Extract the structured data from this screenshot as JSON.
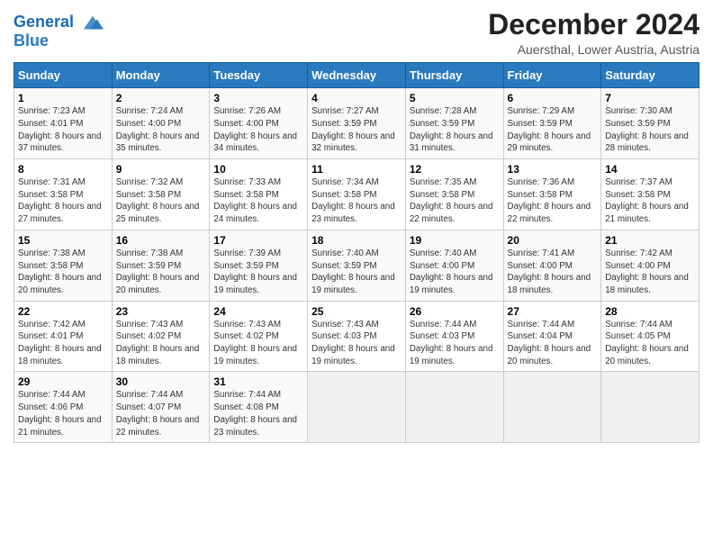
{
  "logo": {
    "line1": "General",
    "line2": "Blue"
  },
  "title": "December 2024",
  "subtitle": "Auersthal, Lower Austria, Austria",
  "header": {
    "days": [
      "Sunday",
      "Monday",
      "Tuesday",
      "Wednesday",
      "Thursday",
      "Friday",
      "Saturday"
    ]
  },
  "weeks": [
    [
      {
        "day": "1",
        "rise": "7:23 AM",
        "set": "4:01 PM",
        "daylight": "8 hours and 37 minutes."
      },
      {
        "day": "2",
        "rise": "7:24 AM",
        "set": "4:00 PM",
        "daylight": "8 hours and 35 minutes."
      },
      {
        "day": "3",
        "rise": "7:26 AM",
        "set": "4:00 PM",
        "daylight": "8 hours and 34 minutes."
      },
      {
        "day": "4",
        "rise": "7:27 AM",
        "set": "3:59 PM",
        "daylight": "8 hours and 32 minutes."
      },
      {
        "day": "5",
        "rise": "7:28 AM",
        "set": "3:59 PM",
        "daylight": "8 hours and 31 minutes."
      },
      {
        "day": "6",
        "rise": "7:29 AM",
        "set": "3:59 PM",
        "daylight": "8 hours and 29 minutes."
      },
      {
        "day": "7",
        "rise": "7:30 AM",
        "set": "3:59 PM",
        "daylight": "8 hours and 28 minutes."
      }
    ],
    [
      {
        "day": "8",
        "rise": "7:31 AM",
        "set": "3:58 PM",
        "daylight": "8 hours and 27 minutes."
      },
      {
        "day": "9",
        "rise": "7:32 AM",
        "set": "3:58 PM",
        "daylight": "8 hours and 25 minutes."
      },
      {
        "day": "10",
        "rise": "7:33 AM",
        "set": "3:58 PM",
        "daylight": "8 hours and 24 minutes."
      },
      {
        "day": "11",
        "rise": "7:34 AM",
        "set": "3:58 PM",
        "daylight": "8 hours and 23 minutes."
      },
      {
        "day": "12",
        "rise": "7:35 AM",
        "set": "3:58 PM",
        "daylight": "8 hours and 22 minutes."
      },
      {
        "day": "13",
        "rise": "7:36 AM",
        "set": "3:58 PM",
        "daylight": "8 hours and 22 minutes."
      },
      {
        "day": "14",
        "rise": "7:37 AM",
        "set": "3:58 PM",
        "daylight": "8 hours and 21 minutes."
      }
    ],
    [
      {
        "day": "15",
        "rise": "7:38 AM",
        "set": "3:58 PM",
        "daylight": "8 hours and 20 minutes."
      },
      {
        "day": "16",
        "rise": "7:38 AM",
        "set": "3:59 PM",
        "daylight": "8 hours and 20 minutes."
      },
      {
        "day": "17",
        "rise": "7:39 AM",
        "set": "3:59 PM",
        "daylight": "8 hours and 19 minutes."
      },
      {
        "day": "18",
        "rise": "7:40 AM",
        "set": "3:59 PM",
        "daylight": "8 hours and 19 minutes."
      },
      {
        "day": "19",
        "rise": "7:40 AM",
        "set": "4:00 PM",
        "daylight": "8 hours and 19 minutes."
      },
      {
        "day": "20",
        "rise": "7:41 AM",
        "set": "4:00 PM",
        "daylight": "8 hours and 18 minutes."
      },
      {
        "day": "21",
        "rise": "7:42 AM",
        "set": "4:00 PM",
        "daylight": "8 hours and 18 minutes."
      }
    ],
    [
      {
        "day": "22",
        "rise": "7:42 AM",
        "set": "4:01 PM",
        "daylight": "8 hours and 18 minutes."
      },
      {
        "day": "23",
        "rise": "7:43 AM",
        "set": "4:02 PM",
        "daylight": "8 hours and 18 minutes."
      },
      {
        "day": "24",
        "rise": "7:43 AM",
        "set": "4:02 PM",
        "daylight": "8 hours and 19 minutes."
      },
      {
        "day": "25",
        "rise": "7:43 AM",
        "set": "4:03 PM",
        "daylight": "8 hours and 19 minutes."
      },
      {
        "day": "26",
        "rise": "7:44 AM",
        "set": "4:03 PM",
        "daylight": "8 hours and 19 minutes."
      },
      {
        "day": "27",
        "rise": "7:44 AM",
        "set": "4:04 PM",
        "daylight": "8 hours and 20 minutes."
      },
      {
        "day": "28",
        "rise": "7:44 AM",
        "set": "4:05 PM",
        "daylight": "8 hours and 20 minutes."
      }
    ],
    [
      {
        "day": "29",
        "rise": "7:44 AM",
        "set": "4:06 PM",
        "daylight": "8 hours and 21 minutes."
      },
      {
        "day": "30",
        "rise": "7:44 AM",
        "set": "4:07 PM",
        "daylight": "8 hours and 22 minutes."
      },
      {
        "day": "31",
        "rise": "7:44 AM",
        "set": "4:08 PM",
        "daylight": "8 hours and 23 minutes."
      },
      null,
      null,
      null,
      null
    ]
  ],
  "labels": {
    "sunrise": "Sunrise: ",
    "sunset": "Sunset: ",
    "daylight": "Daylight: "
  }
}
